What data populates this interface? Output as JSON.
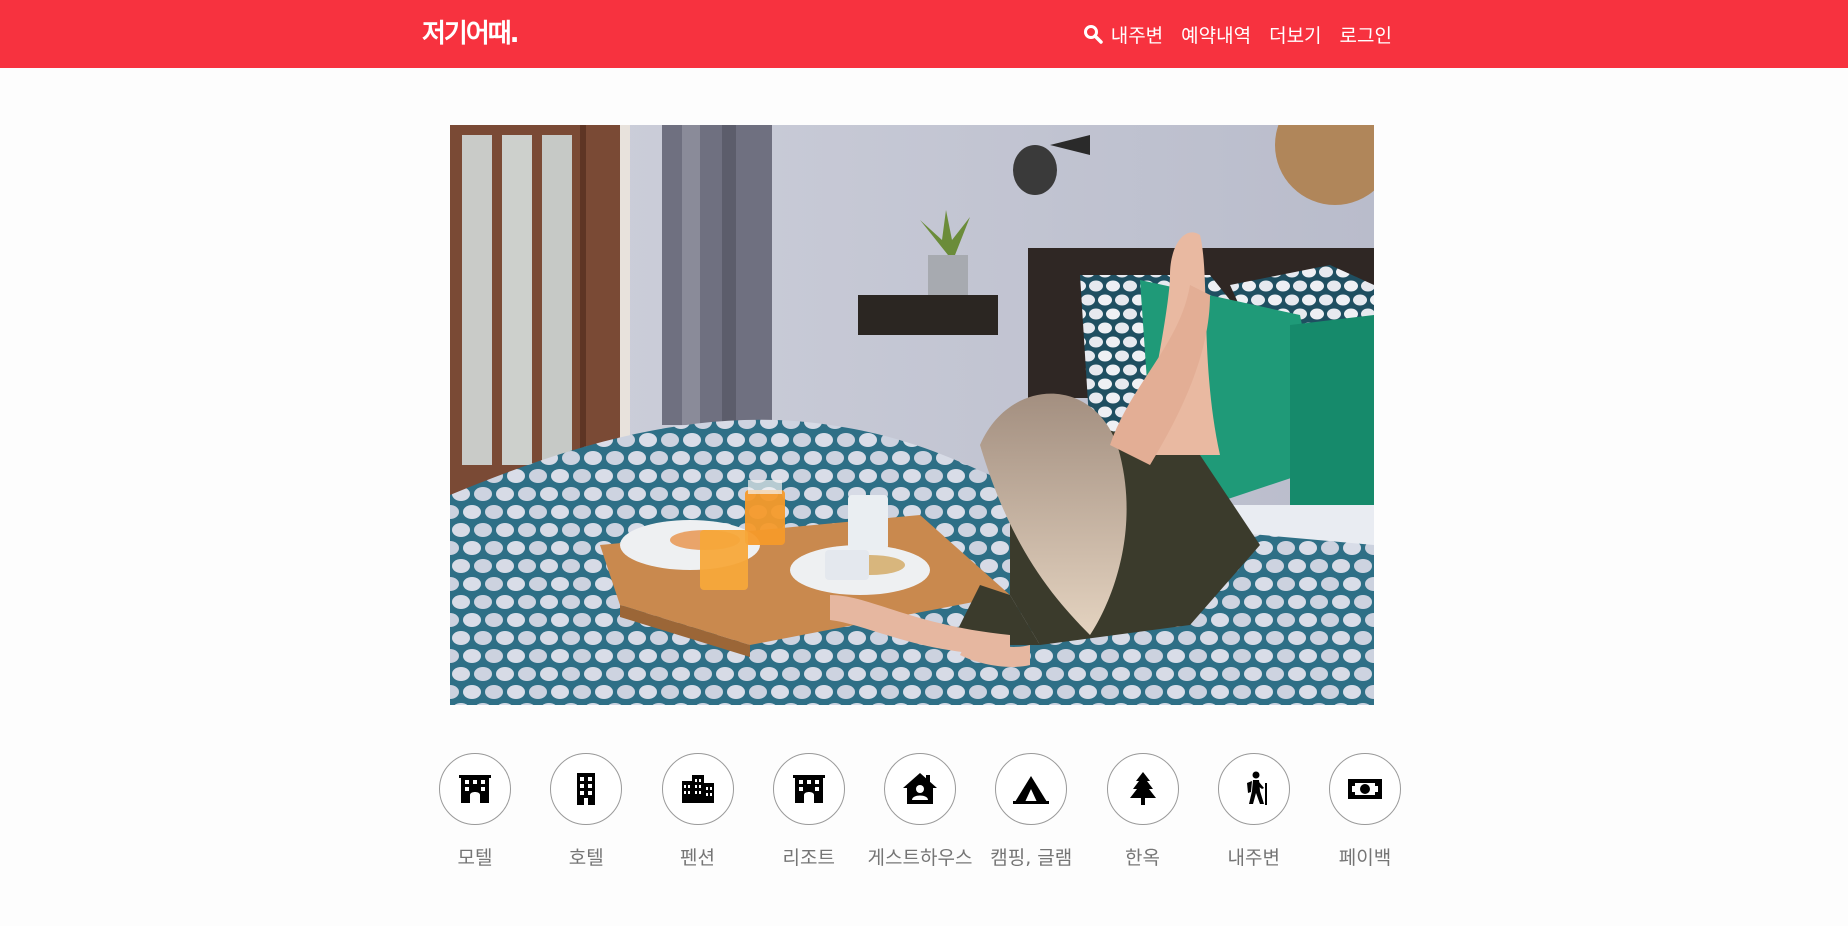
{
  "header": {
    "logo": "저기어때.",
    "nav": [
      {
        "label": "내주변",
        "icon": "search-icon"
      },
      {
        "label": "예약내역"
      },
      {
        "label": "더보기"
      },
      {
        "label": "로그인"
      }
    ]
  },
  "hero": {
    "image": "woman-breakfast-in-bed-photo"
  },
  "categories": [
    {
      "label": "모텔",
      "icon": "motel-icon"
    },
    {
      "label": "호텔",
      "icon": "hotel-icon"
    },
    {
      "label": "펜션",
      "icon": "pension-icon"
    },
    {
      "label": "리조트",
      "icon": "resort-icon"
    },
    {
      "label": "게스트하우스",
      "icon": "guesthouse-icon"
    },
    {
      "label": "캠핑, 글램",
      "icon": "camping-icon"
    },
    {
      "label": "한옥",
      "icon": "hanok-icon"
    },
    {
      "label": "내주변",
      "icon": "nearby-icon"
    },
    {
      "label": "페이백",
      "icon": "payback-icon"
    }
  ],
  "colors": {
    "brand": "#f7323f",
    "icon": "#000000",
    "label": "#757575"
  }
}
